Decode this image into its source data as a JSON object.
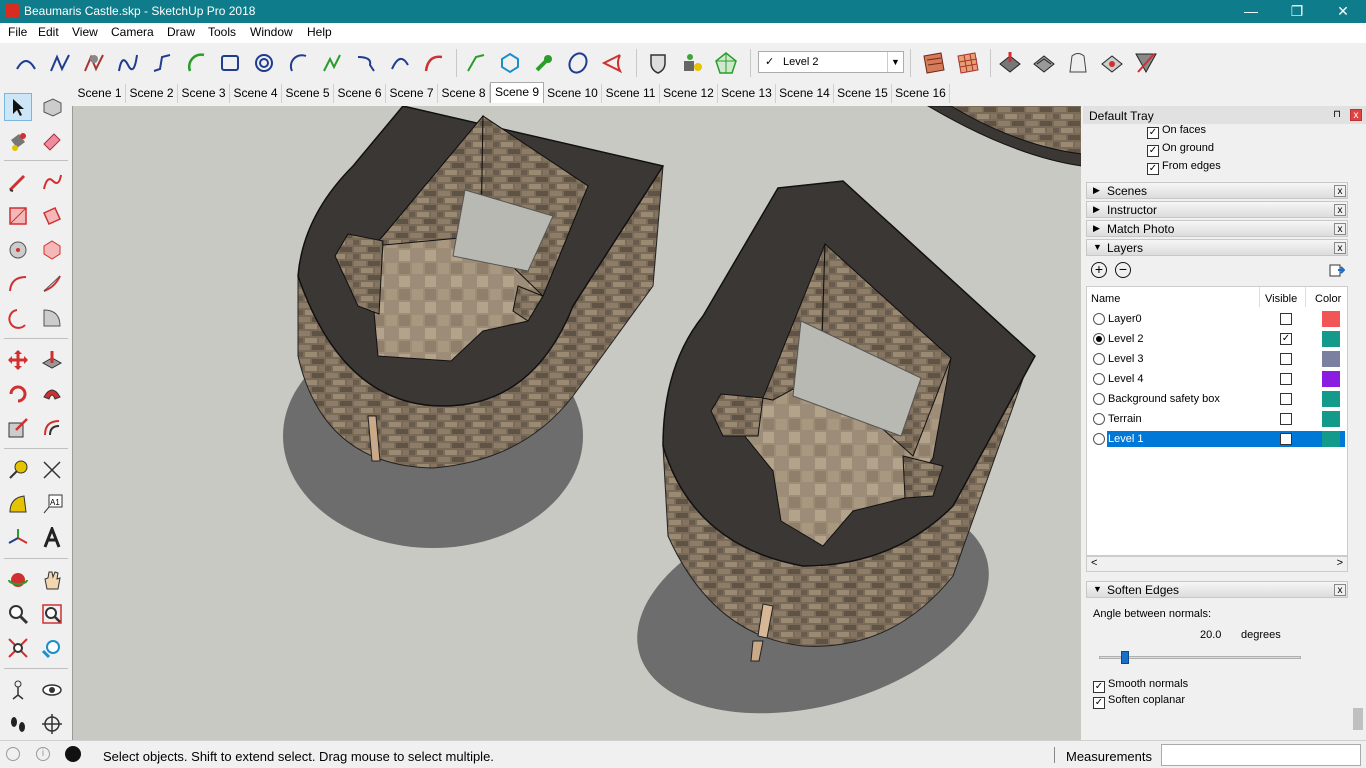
{
  "window": {
    "title": "Beaumaris Castle.skp - SketchUp Pro 2018",
    "minimize": "—",
    "restore": "❐",
    "close": "✕"
  },
  "menu": [
    "File",
    "Edit",
    "View",
    "Camera",
    "Draw",
    "Tools",
    "Window",
    "Help"
  ],
  "toolbar": {
    "icons": [
      "arc-curve-icon",
      "freehand-line-icon",
      "sandbox-smoove-icon",
      "bezier-curve-icon",
      "polyline-icon",
      "arc-green-icon",
      "rectangle-icon",
      "circle-icon",
      "arc-icon",
      "spiral-icon",
      "curve-return-icon",
      "arc-2pt-icon",
      "arc-red-icon",
      "line-green-icon",
      "polygon-icon",
      "wrench-icon",
      "ellipse-icon",
      "pie-icon",
      "shield-icon",
      "paint-bucket-icon",
      "sandbox-mesh-icon"
    ],
    "layer_check": "✓",
    "layer_select": "Level 2",
    "right_icons": [
      "texture-tools-icon",
      "grid-icon",
      "move-vertices-icon",
      "terrain-icon",
      "weld-icon",
      "drape-icon",
      "flip-icon"
    ]
  },
  "scenes": [
    "Scene 1",
    "Scene 2",
    "Scene 3",
    "Scene 4",
    "Scene 5",
    "Scene 6",
    "Scene 7",
    "Scene 8",
    "Scene 9",
    "Scene 10",
    "Scene 11",
    "Scene 12",
    "Scene 13",
    "Scene 14",
    "Scene 15",
    "Scene 16"
  ],
  "active_scene": "Scene 9",
  "tray": {
    "title": "Default Tray",
    "pin": "⊓",
    "close": "x",
    "shadow_options": [
      {
        "label": "On faces",
        "checked": true
      },
      {
        "label": "On ground",
        "checked": true
      },
      {
        "label": "From edges",
        "checked": true
      }
    ],
    "panels": [
      {
        "label": "Scenes",
        "expanded": false
      },
      {
        "label": "Instructor",
        "expanded": false
      },
      {
        "label": "Match Photo",
        "expanded": false
      },
      {
        "label": "Layers",
        "expanded": true
      }
    ],
    "layers": {
      "add": "+",
      "remove": "−",
      "columns": {
        "name": "Name",
        "visible": "Visible",
        "color": "Color"
      },
      "rows": [
        {
          "name": "Layer0",
          "active": false,
          "visible": false,
          "color": "#f25555",
          "selected": false
        },
        {
          "name": "Level 2",
          "active": true,
          "visible": true,
          "color": "#139a8a",
          "selected": false
        },
        {
          "name": "Level 3",
          "active": false,
          "visible": false,
          "color": "#7b7fa0",
          "selected": false
        },
        {
          "name": "Level 4",
          "active": false,
          "visible": false,
          "color": "#8a1de0",
          "selected": false
        },
        {
          "name": "Background safety box",
          "active": false,
          "visible": false,
          "color": "#139a8a",
          "selected": false
        },
        {
          "name": "Terrain",
          "active": false,
          "visible": false,
          "color": "#139a8a",
          "selected": false
        },
        {
          "name": "Level 1",
          "active": false,
          "visible": false,
          "color": "#139a8a",
          "selected": true
        }
      ]
    },
    "soften": {
      "label": "Soften Edges",
      "angle_label": "Angle between normals:",
      "angle_value": "20.0",
      "angle_unit": "degrees",
      "angle_fraction": 0.11,
      "smooth": {
        "label": "Smooth normals",
        "checked": true
      },
      "coplanar": {
        "label": "Soften coplanar",
        "checked": true
      }
    }
  },
  "status": {
    "message": "Select objects. Shift to extend select. Drag mouse to select multiple.",
    "measurements_label": "Measurements",
    "measurements_value": ""
  },
  "colors": {
    "titlebar": "#0e7c8a",
    "selection": "#0078d7",
    "stone_top": "#3b3734",
    "stone_wall": "#7a6a58"
  }
}
